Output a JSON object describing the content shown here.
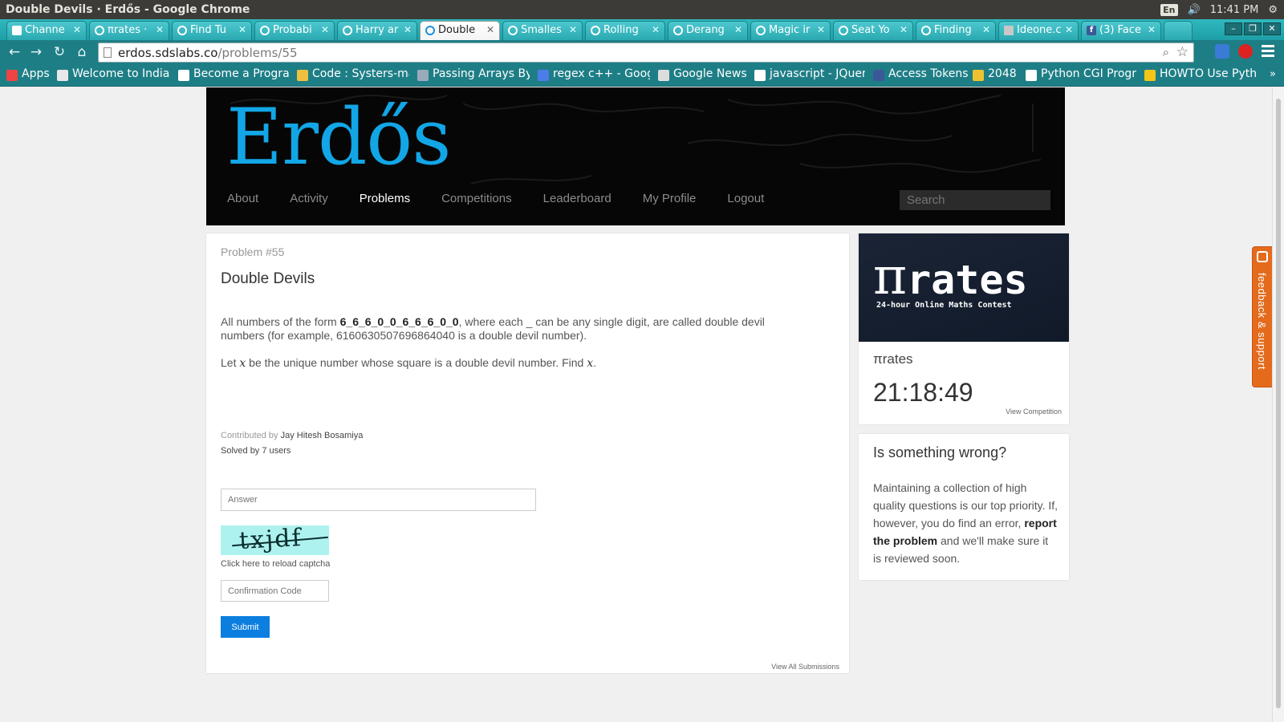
{
  "os": {
    "window_title": "Double Devils · Erdős - Google Chrome",
    "keyboard": "En",
    "clock": "11:41 PM"
  },
  "tabs": [
    {
      "label": "Channe",
      "icon": "grid-icon"
    },
    {
      "label": "πrates ·",
      "icon": "erdos-icon"
    },
    {
      "label": "Find Tu",
      "icon": "erdos-icon"
    },
    {
      "label": "Probabi",
      "icon": "erdos-icon"
    },
    {
      "label": "Harry ar",
      "icon": "erdos-icon"
    },
    {
      "label": "Double",
      "icon": "erdos-icon",
      "active": true
    },
    {
      "label": "Smalles",
      "icon": "erdos-icon"
    },
    {
      "label": "Rolling",
      "icon": "erdos-icon"
    },
    {
      "label": "Derang",
      "icon": "erdos-icon"
    },
    {
      "label": "Magic ir",
      "icon": "erdos-icon"
    },
    {
      "label": "Seat Yo",
      "icon": "erdos-icon"
    },
    {
      "label": "Finding",
      "icon": "erdos-icon"
    },
    {
      "label": "Ideone.c",
      "icon": "ideone-icon"
    },
    {
      "label": "(3) Face",
      "icon": "facebook-icon"
    }
  ],
  "omnibox": {
    "host": "erdos.sdslabs.co",
    "path": "/problems/55"
  },
  "bookmarks": [
    {
      "label": "Apps"
    },
    {
      "label": "Welcome to Indian"
    },
    {
      "label": "Become a Program"
    },
    {
      "label": "Code : Systers-mail"
    },
    {
      "label": "Passing Arrays By F"
    },
    {
      "label": "regex c++ - Google"
    },
    {
      "label": "Google News"
    },
    {
      "label": "javascript - JQuery"
    },
    {
      "label": "Access Tokens"
    },
    {
      "label": "2048"
    },
    {
      "label": "Python CGI Progra"
    },
    {
      "label": "HOWTO Use Pytho"
    }
  ],
  "site": {
    "logo": "Erdős",
    "nav": [
      "About",
      "Activity",
      "Problems",
      "Competitions",
      "Leaderboard",
      "My Profile",
      "Logout"
    ],
    "search_placeholder": "Search"
  },
  "problem": {
    "number": "Problem #55",
    "title": "Double Devils",
    "text_a": "All numbers of the form ",
    "pattern": "6_6_6_0_0_6_6_6_0_0",
    "text_b": ", where each _ can be any single digit, are called double devil numbers (for example, 6160630507696864040 is a double devil number).",
    "text_c": "Let ",
    "var": "x",
    "text_d": " be the unique number whose square is a double devil number. Find ",
    "var2": "x",
    "text_e": ".",
    "contributed_by_label": "Contributed by ",
    "contributor": "Jay Hitesh Bosamiya",
    "solved": "Solved by 7 users",
    "answer_placeholder": "Answer",
    "captcha_text": "txjdf",
    "reload_captcha": "Click here to reload captcha",
    "confirm_placeholder": "Confirmation Code",
    "submit": "Submit",
    "view_all": "View All Submissions"
  },
  "contest": {
    "banner_logo_pi": "π",
    "banner_logo_rest": "rates",
    "banner_tagline": "24-hour Online Maths Contest",
    "name": "πrates",
    "timer": "21:18:49",
    "view_link": "View Competition"
  },
  "report": {
    "title": "Is something wrong?",
    "body_a": "Maintaining a collection of high quality questions is our top priority. If, however, you do find an error, ",
    "body_link": "report the problem",
    "body_b": " and we'll make sure it is reviewed soon."
  },
  "feedback": {
    "label": "feedback & support"
  },
  "colors": {
    "accent_blue": "#12a6e6",
    "chrome_teal": "#1e7e86",
    "submit_blue": "#0c7ee0",
    "feedback_orange": "#e46a1c"
  }
}
